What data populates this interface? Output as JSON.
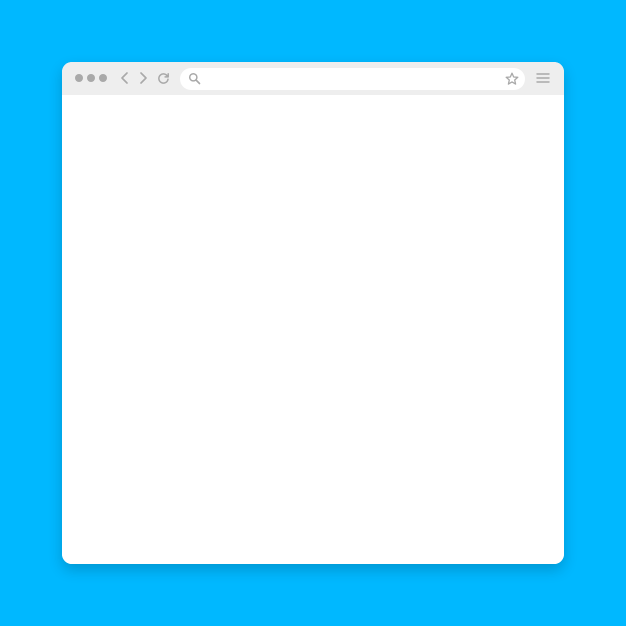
{
  "browser": {
    "address_bar": {
      "value": "",
      "placeholder": ""
    },
    "icons": {
      "window_controls": "dots-icon",
      "back": "back-arrow-icon",
      "forward": "forward-arrow-icon",
      "reload": "reload-icon",
      "search": "search-icon",
      "bookmark": "star-icon",
      "menu": "hamburger-menu-icon"
    }
  },
  "colors": {
    "background": "#00B8FF",
    "window": "#FFFFFF",
    "toolbar": "#EEEEEE",
    "icon": "#A9A9A9"
  }
}
